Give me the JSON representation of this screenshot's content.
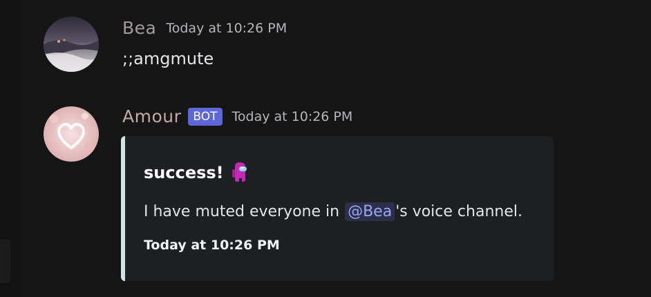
{
  "messages": [
    {
      "username": "Bea",
      "username_color": "#a39a9e",
      "timestamp": "Today at 10:26 PM",
      "content": ";;amgmute",
      "avatar_icon": "user-avatar-photo"
    },
    {
      "username": "Amour",
      "username_color": "#c2aaa8",
      "badge": "BOT",
      "timestamp": "Today at 10:26 PM",
      "avatar_icon": "heart-avatar",
      "embed": {
        "accent_color": "#cfe5e1",
        "title": "success!",
        "title_icon": "crewmate-icon",
        "description_prefix": "I have muted everyone in ",
        "mention": "@Bea",
        "description_suffix": "'s voice channel.",
        "footer_timestamp": "Today at 10:26 PM"
      }
    }
  ]
}
